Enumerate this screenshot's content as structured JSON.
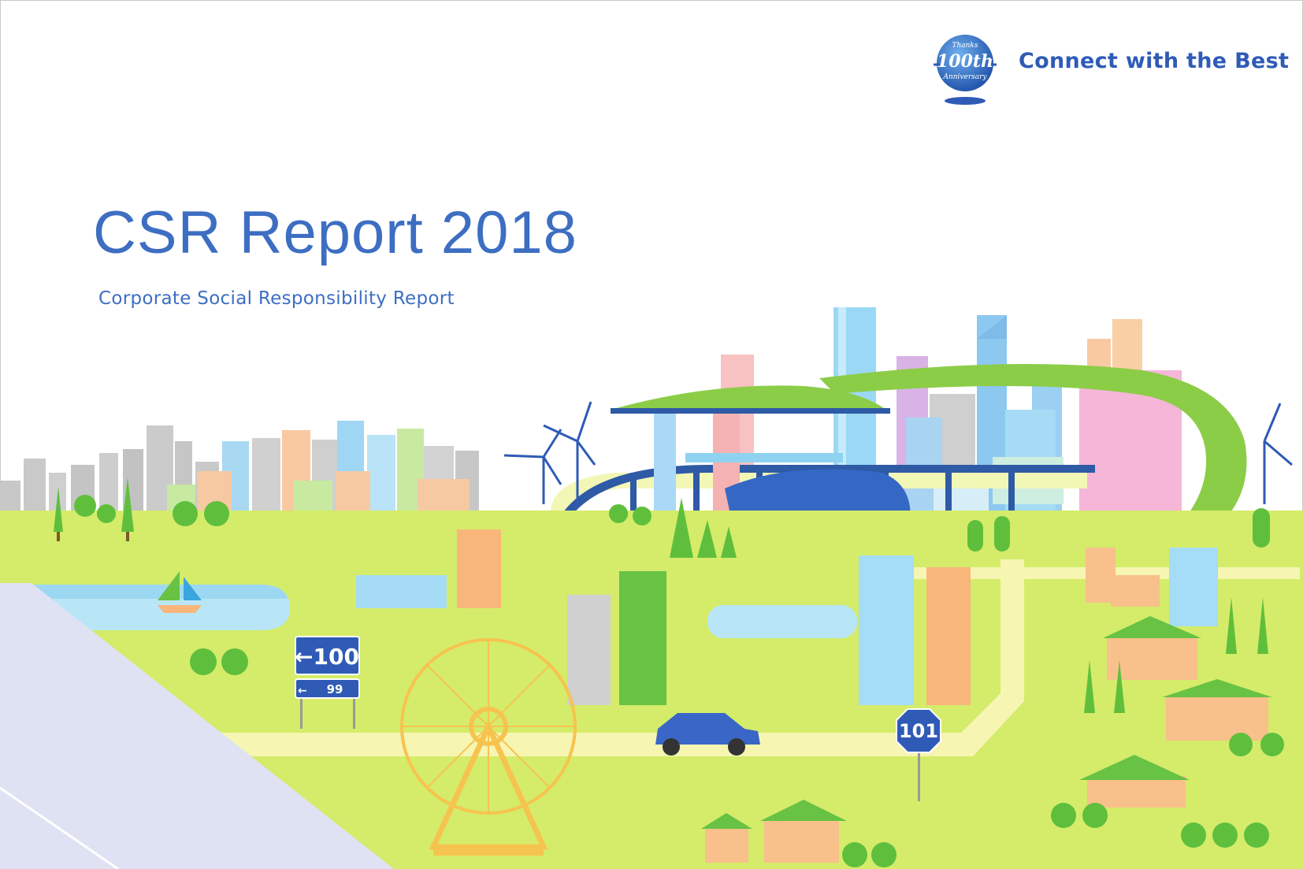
{
  "brand": {
    "badge_top": "Thanks",
    "badge_number": "100th",
    "badge_bottom": "Anniversary",
    "tagline": "Connect with the Best"
  },
  "cover": {
    "title": "CSR Report 2018",
    "subtitle": "Corporate Social Responsibility Report"
  },
  "signs": {
    "direction_main": "←100",
    "direction_small": "99",
    "route": "101"
  },
  "colors": {
    "title_blue": "#3d6ec2",
    "tagline_blue": "#2f5bb6",
    "grass": "#d4ec6a",
    "road": "#f6f5b2",
    "highway": "#dfe2f3"
  }
}
